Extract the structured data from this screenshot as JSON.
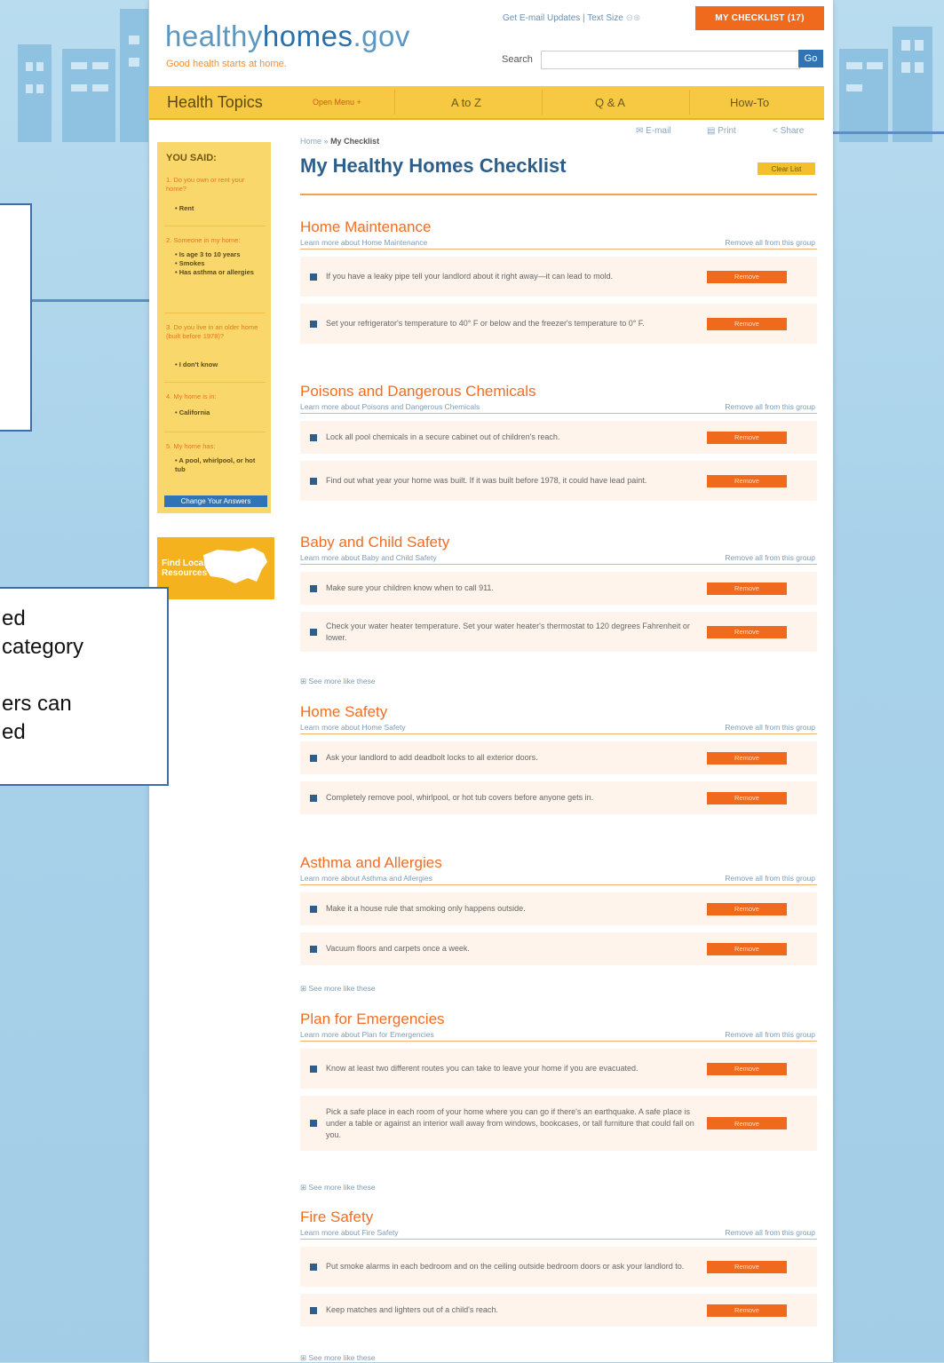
{
  "site": {
    "logo_light": "healthy",
    "logo_bold": "homes",
    "logo_suffix": ".gov",
    "tagline": "Good health starts at home."
  },
  "header": {
    "links_text": "Get E-mail Updates  |  Text Size",
    "checklist_label": "MY CHECKLIST (17)",
    "search_label": "Search",
    "search_placeholder": "",
    "go_label": "Go"
  },
  "nav": {
    "items": [
      "Health Topics",
      "Open Menu +",
      "A to Z",
      "Q & A",
      "How-To"
    ]
  },
  "actions": {
    "email": "E-mail",
    "print": "Print",
    "share": "Share"
  },
  "sidebar": {
    "title": "YOU SAID:",
    "qa": [
      {
        "q": "1. Do you own or rent your home?",
        "a": "• Rent"
      },
      {
        "q": "2. Someone in my home:",
        "a": "• Is age 3 to 10 years\n• Smokes\n• Has asthma or allergies"
      },
      {
        "q": "3. Do you live in an older home (built before 1978)?",
        "a": "• I don't know"
      },
      {
        "q": "4. My home is in:",
        "a": "• California"
      },
      {
        "q": "5. My home has:",
        "a": "• A pool, whirlpool, or hot tub"
      }
    ],
    "change_label": "Change Your Answers",
    "find_label": "Find Local Resources"
  },
  "main": {
    "breadcrumb_home": "Home",
    "breadcrumb_sep": "»",
    "breadcrumb_current": "My Checklist",
    "title": "My Healthy Homes Checklist",
    "clear_label": "Clear List",
    "remove_all_label": "Remove all from this group",
    "remove_label": "Remove",
    "see_more_label": "⊞ See more like these",
    "sections": [
      {
        "title": "Home Maintenance",
        "learn": "Learn more about Home Maintenance",
        "items": [
          "If you have a leaky pipe tell your landlord about it right away—it can lead to mold.",
          "Set your refrigerator's temperature to 40° F or below and the freezer's temperature to 0° F."
        ]
      },
      {
        "title": "Poisons and Dangerous Chemicals",
        "learn": "Learn more about Poisons and Dangerous Chemicals",
        "items": [
          "Lock all pool chemicals in a secure cabinet out of children's reach.",
          "Find out what year your home was built. If it was built before 1978, it could have lead paint."
        ]
      },
      {
        "title": "Baby and Child Safety",
        "learn": "Learn more about Baby and Child Safety",
        "items": [
          "Make sure your children know when to call 911.",
          "Check your water heater temperature. Set your water heater's thermostat to 120 degrees Fahrenheit or lower."
        ]
      },
      {
        "title": "Home Safety",
        "learn": "Learn more about Home Safety",
        "items": [
          "Ask your landlord to add deadbolt locks to all exterior doors.",
          "Completely remove pool, whirlpool, or hot tub covers before anyone gets in."
        ]
      },
      {
        "title": "Asthma and Allergies",
        "learn": "Learn more about Asthma and Allergies",
        "items": [
          "Make it a house rule that smoking only happens outside.",
          "Vacuum floors and carpets once a week."
        ]
      },
      {
        "title": "Plan for Emergencies",
        "learn": "Learn more about Plan for Emergencies",
        "items": [
          "Know at least two different routes you can take to leave your home if you are evacuated.",
          "Pick a safe place in each room of your home where you can go if there's an earthquake. A safe place is under a table or against an interior wall away from windows, bookcases, or tall furniture that could fall on you."
        ]
      },
      {
        "title": "Fire Safety",
        "learn": "Learn more about Fire Safety",
        "items": [
          "Put smoke alarms in each bedroom and on the ceiling outside bedroom doors or ask your landlord to.",
          "Keep matches and lighters out of a child's reach."
        ]
      }
    ]
  },
  "callout": {
    "text": "ed\ncategory\n\ners can\ned"
  }
}
